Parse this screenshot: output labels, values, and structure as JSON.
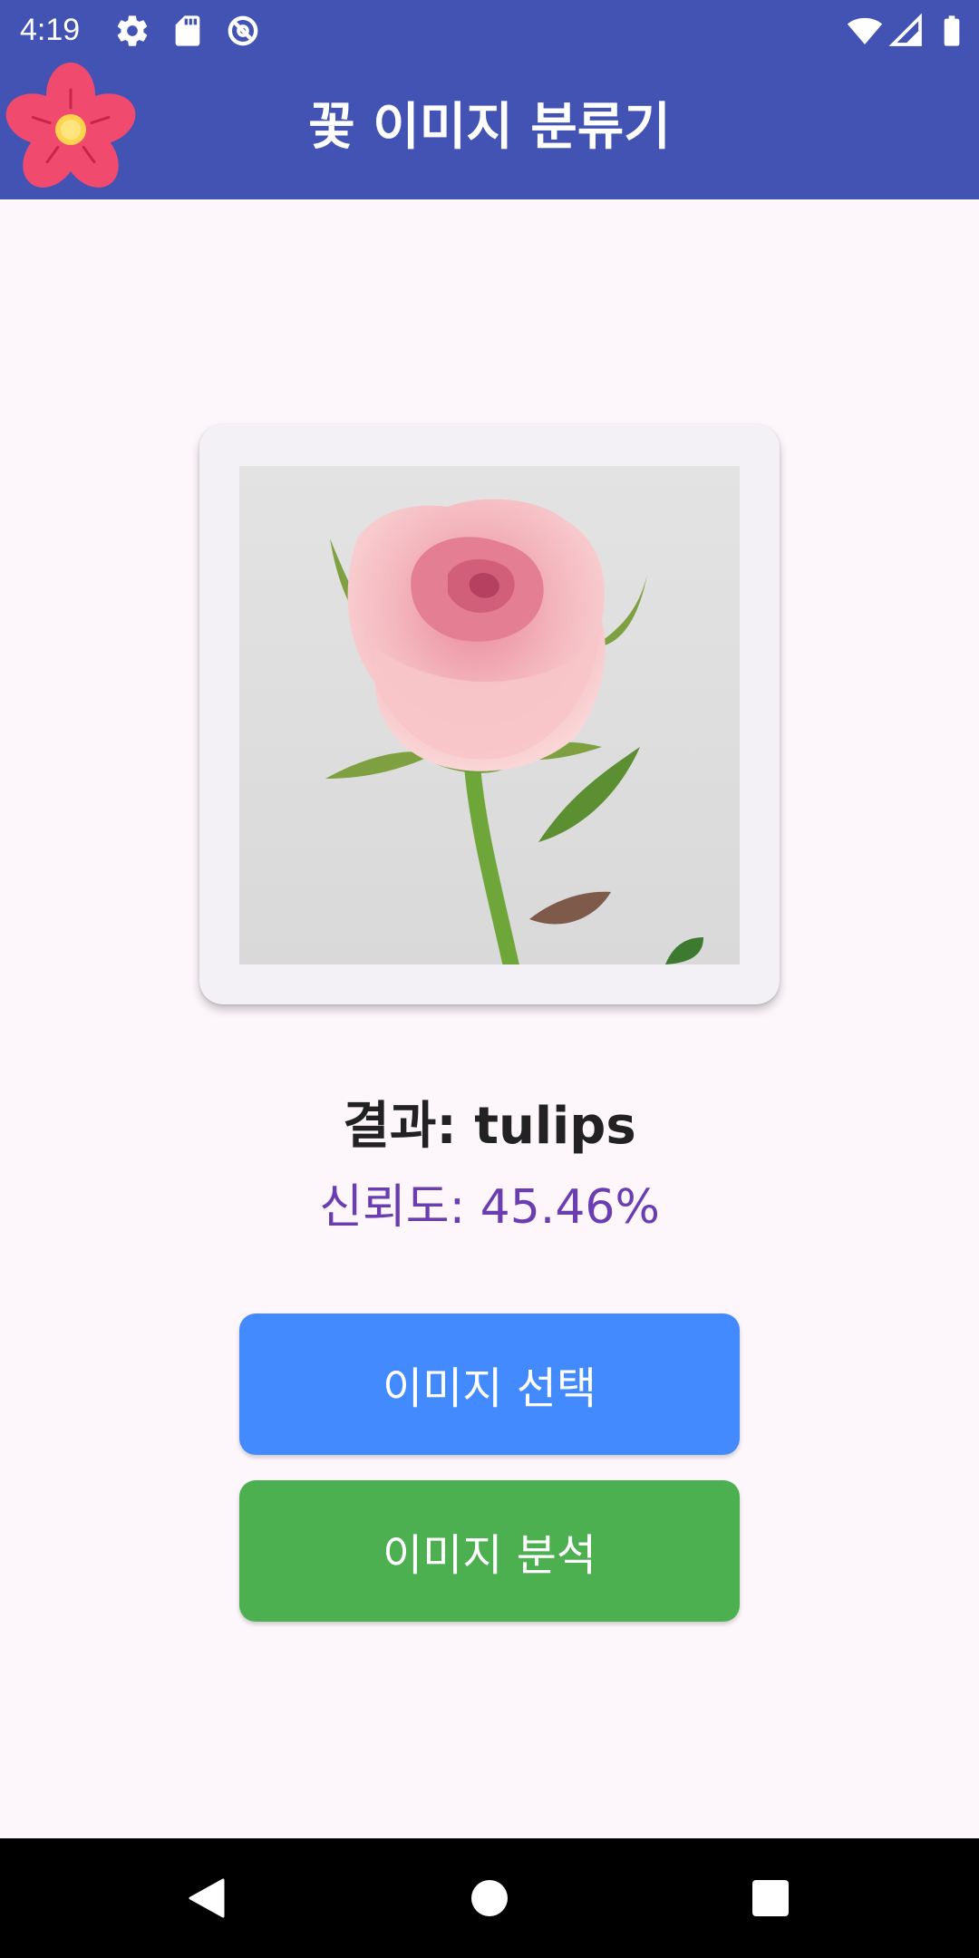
{
  "status_bar": {
    "time": "4:19",
    "icons_left": [
      "settings-icon",
      "sd-card-icon",
      "sync-disabled-icon"
    ],
    "icons_right": [
      "wifi-icon",
      "signal-icon",
      "battery-icon"
    ]
  },
  "app_bar": {
    "title": "꽃 이미지 분류기",
    "logo_icon": "flower-icon"
  },
  "image_card": {
    "subject": "pink rose photo"
  },
  "result": {
    "result_text": "결과: tulips",
    "confidence_text": "신뢰도: 45.46%"
  },
  "buttons": {
    "select_label": "이미지 선택",
    "analyze_label": "이미지 분석"
  },
  "nav_bar": {
    "icons": [
      "back-icon",
      "home-icon",
      "recents-icon"
    ]
  },
  "colors": {
    "primary": "#4353B3",
    "background": "#FDF7FC",
    "select_button": "#448AFF",
    "analyze_button": "#4CAF50",
    "confidence_text": "#6A3DB0"
  }
}
